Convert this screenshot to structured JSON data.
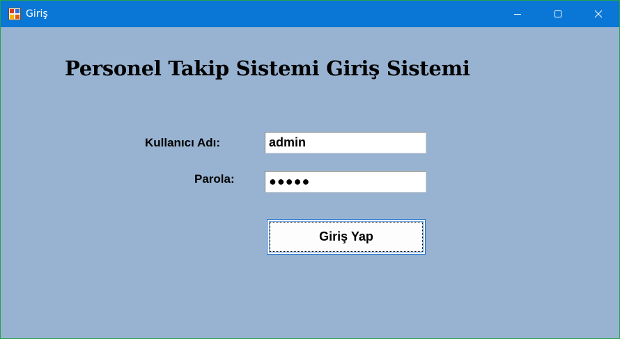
{
  "window": {
    "title": "Giriş",
    "icon": "winforms-app-icon",
    "controls": {
      "minimize_icon": "minimize-icon",
      "maximize_icon": "maximize-icon",
      "close_icon": "close-icon"
    }
  },
  "form": {
    "heading": "Personel Takip Sistemi Giriş Sistemi",
    "username_label": "Kullanıcı Adı:",
    "username_value": "admin",
    "password_label": "Parola:",
    "password_value": "●●●●●",
    "login_button_label": "Giriş Yap"
  },
  "colors": {
    "titlebar": "#0a77d6",
    "form_background": "#98b3d1",
    "button_border": "#1d6fc9"
  }
}
